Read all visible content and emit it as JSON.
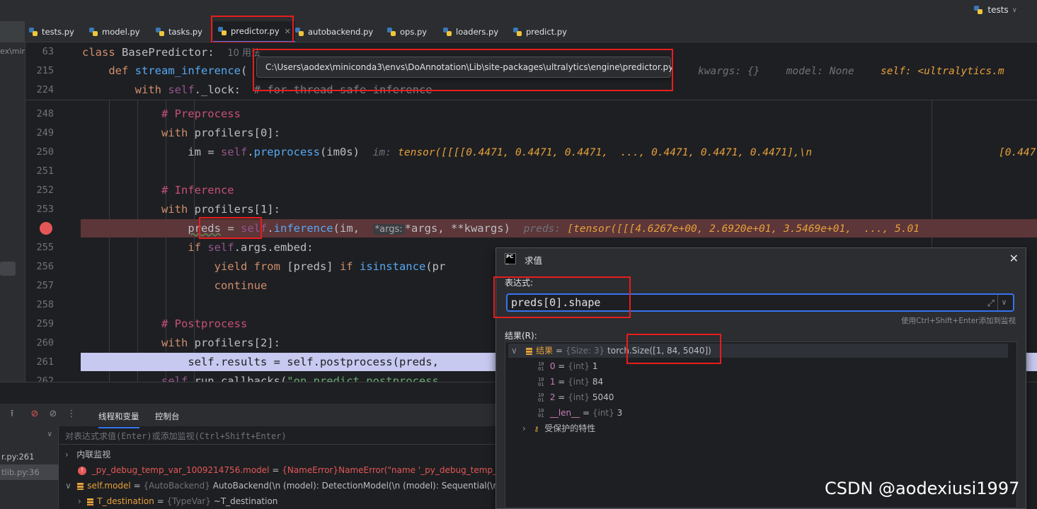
{
  "run_config": {
    "name": "tests"
  },
  "tabs": [
    {
      "label": "tests.py"
    },
    {
      "label": "model.py"
    },
    {
      "label": "tasks.py"
    },
    {
      "label": "predictor.py",
      "active": true
    },
    {
      "label": "autobackend.py"
    },
    {
      "label": "ops.py"
    },
    {
      "label": "loaders.py"
    },
    {
      "label": "predict.py"
    }
  ],
  "left_fragment": "ex\\min",
  "tooltip_path": "C:\\Users\\aodex\\miniconda3\\envs\\DoAnnotation\\Lib\\site-packages\\ultralytics\\engine\\predictor.py",
  "sticky": {
    "l63": "63",
    "l215": "215",
    "l224": "224",
    "usages": "10 用法",
    "kw_params": "kwargs: {}",
    "model_param": "model: None",
    "self_param": "self: <ultralytics.m"
  },
  "lines": {
    "n248": "248",
    "n249": "249",
    "n250": "250",
    "n251": "251",
    "n252": "252",
    "n253": "253",
    "n255": "255",
    "n256": "256",
    "n257": "257",
    "n258": "258",
    "n259": "259",
    "n260": "260",
    "n261": "261",
    "n262": "262",
    "c248": "# Preprocess",
    "c252": "# Inference",
    "c259": "# Postprocess",
    "inlay_im": "im:",
    "inlay_im_val": "tensor([[[[0.4471, 0.4471, 0.4471,  ..., 0.4471, 0.4471, 0.4471],\\n",
    "inlay_im_tail": "[0.447",
    "inlay_args": "*args:",
    "inlay_preds": "preds:",
    "inlay_preds_val": "[tensor([[[4.6267e+00, 2.6920e+01, 3.5469e+01,  ..., 5.01"
  },
  "debugger": {
    "tab_threads": "线程和变量",
    "tab_console": "控制台",
    "frames": [
      "r.py:261",
      "tlib.py:36"
    ],
    "eval_placeholder": "对表达式求值(Enter)或添加监视(Ctrl+Shift+Enter)",
    "inline_watch": "内联监视",
    "row_debug_name": "_py_debug_temp_var_1009214756.model",
    "row_debug_val": "{NameError}NameError(\"name '_py_debug_temp_var_",
    "row_model_name": "self.model",
    "row_model_type": "{AutoBackend}",
    "row_model_val": "AutoBackend(\\n  (model): DetectionModel(\\n    (model): Sequential(\\n",
    "row_tdest_name": "T_destination",
    "row_tdest_type": "{TypeVar}",
    "row_tdest_val": "~T_destination"
  },
  "evaluate": {
    "title": "求值",
    "expr_label": "表达式:",
    "expr_value": "preds[0].shape",
    "hint": "使用Ctrl+Shift+Enter添加到监视",
    "result_label": "结果(R):",
    "result_name": "结果",
    "result_type": "{Size: 3}",
    "result_val": "torch.Size([1, 84, 5040])",
    "items": [
      {
        "name": "0",
        "type": "{int}",
        "value": "1"
      },
      {
        "name": "1",
        "type": "{int}",
        "value": "84"
      },
      {
        "name": "2",
        "type": "{int}",
        "value": "5040"
      },
      {
        "name": "__len__",
        "type": "{int}",
        "value": "3"
      }
    ],
    "protected": "受保护的特性"
  },
  "watermark": "CSDN @aodexiusi1997"
}
